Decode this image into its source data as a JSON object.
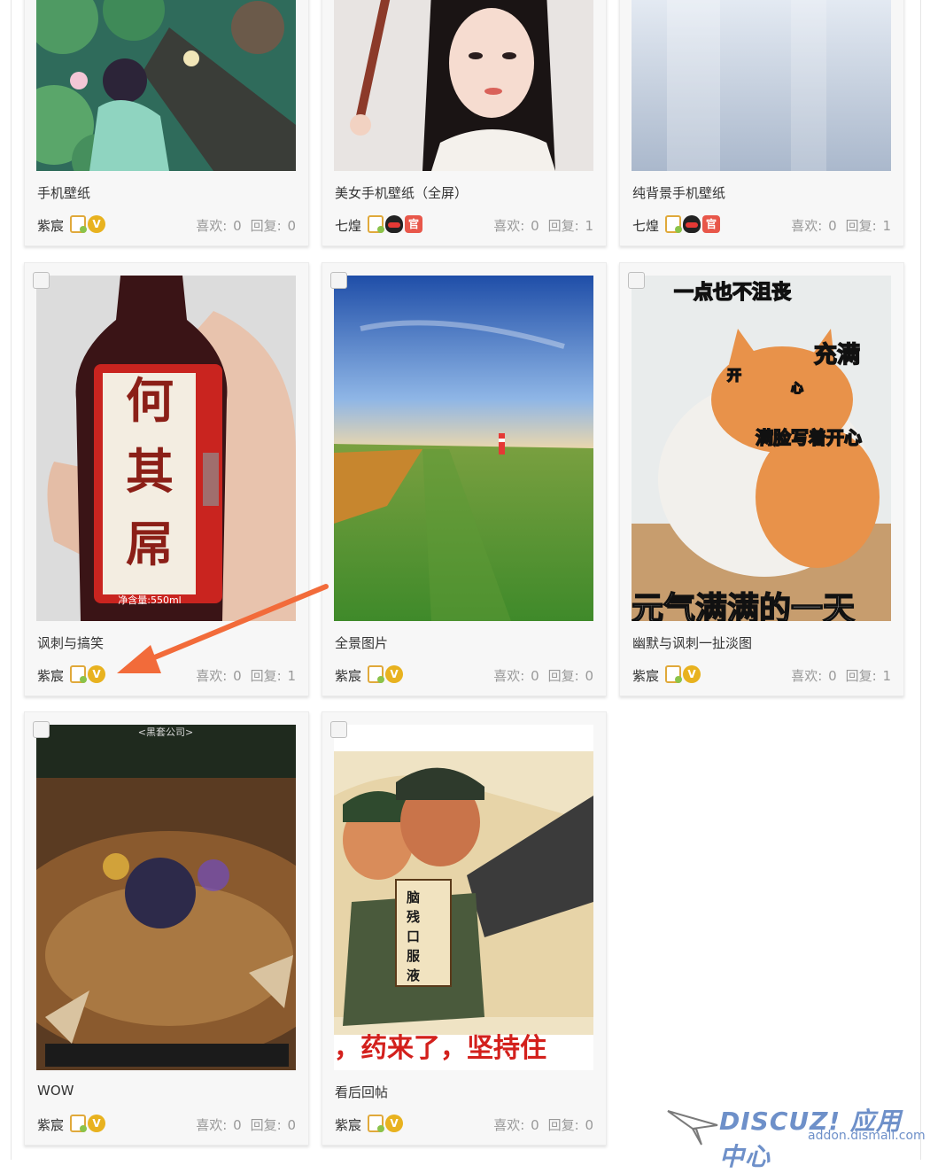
{
  "cards": [
    {
      "title": "手机壁纸",
      "author": "紫宸",
      "likes": "喜欢: 0",
      "replies": "回复: 0",
      "badges": [
        "doc",
        "v"
      ]
    },
    {
      "title": "美女手机壁纸（全屏）",
      "author": "七煌",
      "likes": "喜欢: 0",
      "replies": "回复: 1",
      "badges": [
        "doc",
        "qq",
        "gov"
      ]
    },
    {
      "title": "纯背景手机壁纸",
      "author": "七煌",
      "likes": "喜欢: 0",
      "replies": "回复: 1",
      "badges": [
        "doc",
        "qq",
        "gov"
      ]
    },
    {
      "title": "讽刺与搞笑",
      "author": "紫宸",
      "likes": "喜欢: 0",
      "replies": "回复: 1",
      "badges": [
        "doc",
        "v"
      ]
    },
    {
      "title": "全景图片",
      "author": "紫宸",
      "likes": "喜欢: 0",
      "replies": "回复: 0",
      "badges": [
        "doc",
        "v"
      ]
    },
    {
      "title": "幽默与讽刺一扯淡图",
      "author": "紫宸",
      "likes": "喜欢: 0",
      "replies": "回复: 1",
      "badges": [
        "doc",
        "v"
      ]
    },
    {
      "title": "WOW",
      "author": "紫宸",
      "likes": "喜欢: 0",
      "replies": "回复: 0",
      "badges": [
        "doc",
        "v"
      ]
    },
    {
      "title": "看后回帖",
      "author": "紫宸",
      "likes": "喜欢: 0",
      "replies": "回复: 0",
      "badges": [
        "doc",
        "v"
      ]
    }
  ],
  "badge_text": {
    "v": "V",
    "gov": "官"
  },
  "image_text": {
    "bottle_big": "何其屌",
    "bottle_small": "净含量:550ml",
    "cat_top": "一点也不沮丧",
    "cat_right": "充满",
    "cat_kai": "开",
    "cat_xin": "心",
    "cat_mid": "满脸写着开心",
    "cat_bottom": "元气满满的一天",
    "wow_top": "<黑套公司>",
    "poster_book": "脑残口服液",
    "poster_bottom": "，药来了，坚持住"
  },
  "watermark": {
    "main": "DISCUZ! 应用中心",
    "sub": "addon.dismall.com"
  },
  "colors": {
    "arrow": "#f26b3a",
    "logo": "#6e90c9",
    "badge_gold": "#e8b21f",
    "badge_red": "#e8574a"
  }
}
